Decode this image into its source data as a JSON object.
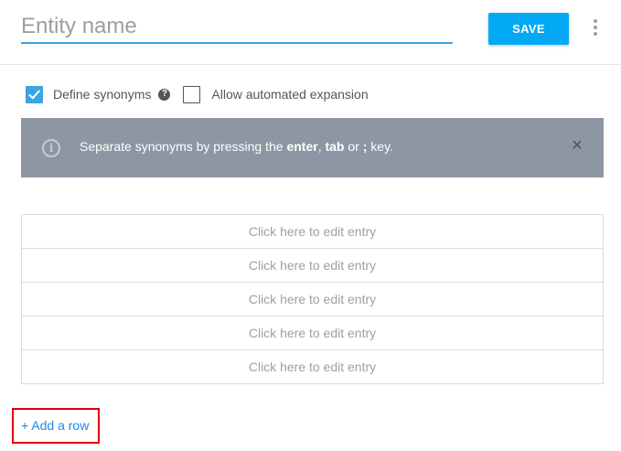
{
  "header": {
    "entity_name_placeholder": "Entity name",
    "save_label": "SAVE"
  },
  "options": {
    "define_synonyms": {
      "label": "Define synonyms",
      "checked": true,
      "help_icon": "question-circle-icon"
    },
    "automated_expansion": {
      "label": "Allow automated expansion",
      "checked": false
    }
  },
  "banner": {
    "text_1": "Separate synonyms by pressing the ",
    "key_enter": "enter",
    "text_2": ", ",
    "key_tab": "tab",
    "text_3": " or ",
    "key_semicolon": ";",
    "text_4": " key.",
    "close_icon": "close-icon",
    "info_icon": "info-circle-icon"
  },
  "entries": [
    {
      "placeholder": "Click here to edit entry"
    },
    {
      "placeholder": "Click here to edit entry"
    },
    {
      "placeholder": "Click here to edit entry"
    },
    {
      "placeholder": "Click here to edit entry"
    },
    {
      "placeholder": "Click here to edit entry"
    }
  ],
  "add_row_label": "+ Add a row",
  "colors": {
    "accent": "#03a9f4",
    "banner_bg": "#8e96a3",
    "highlight_box": "#e0000d",
    "link": "#1e88e5"
  }
}
